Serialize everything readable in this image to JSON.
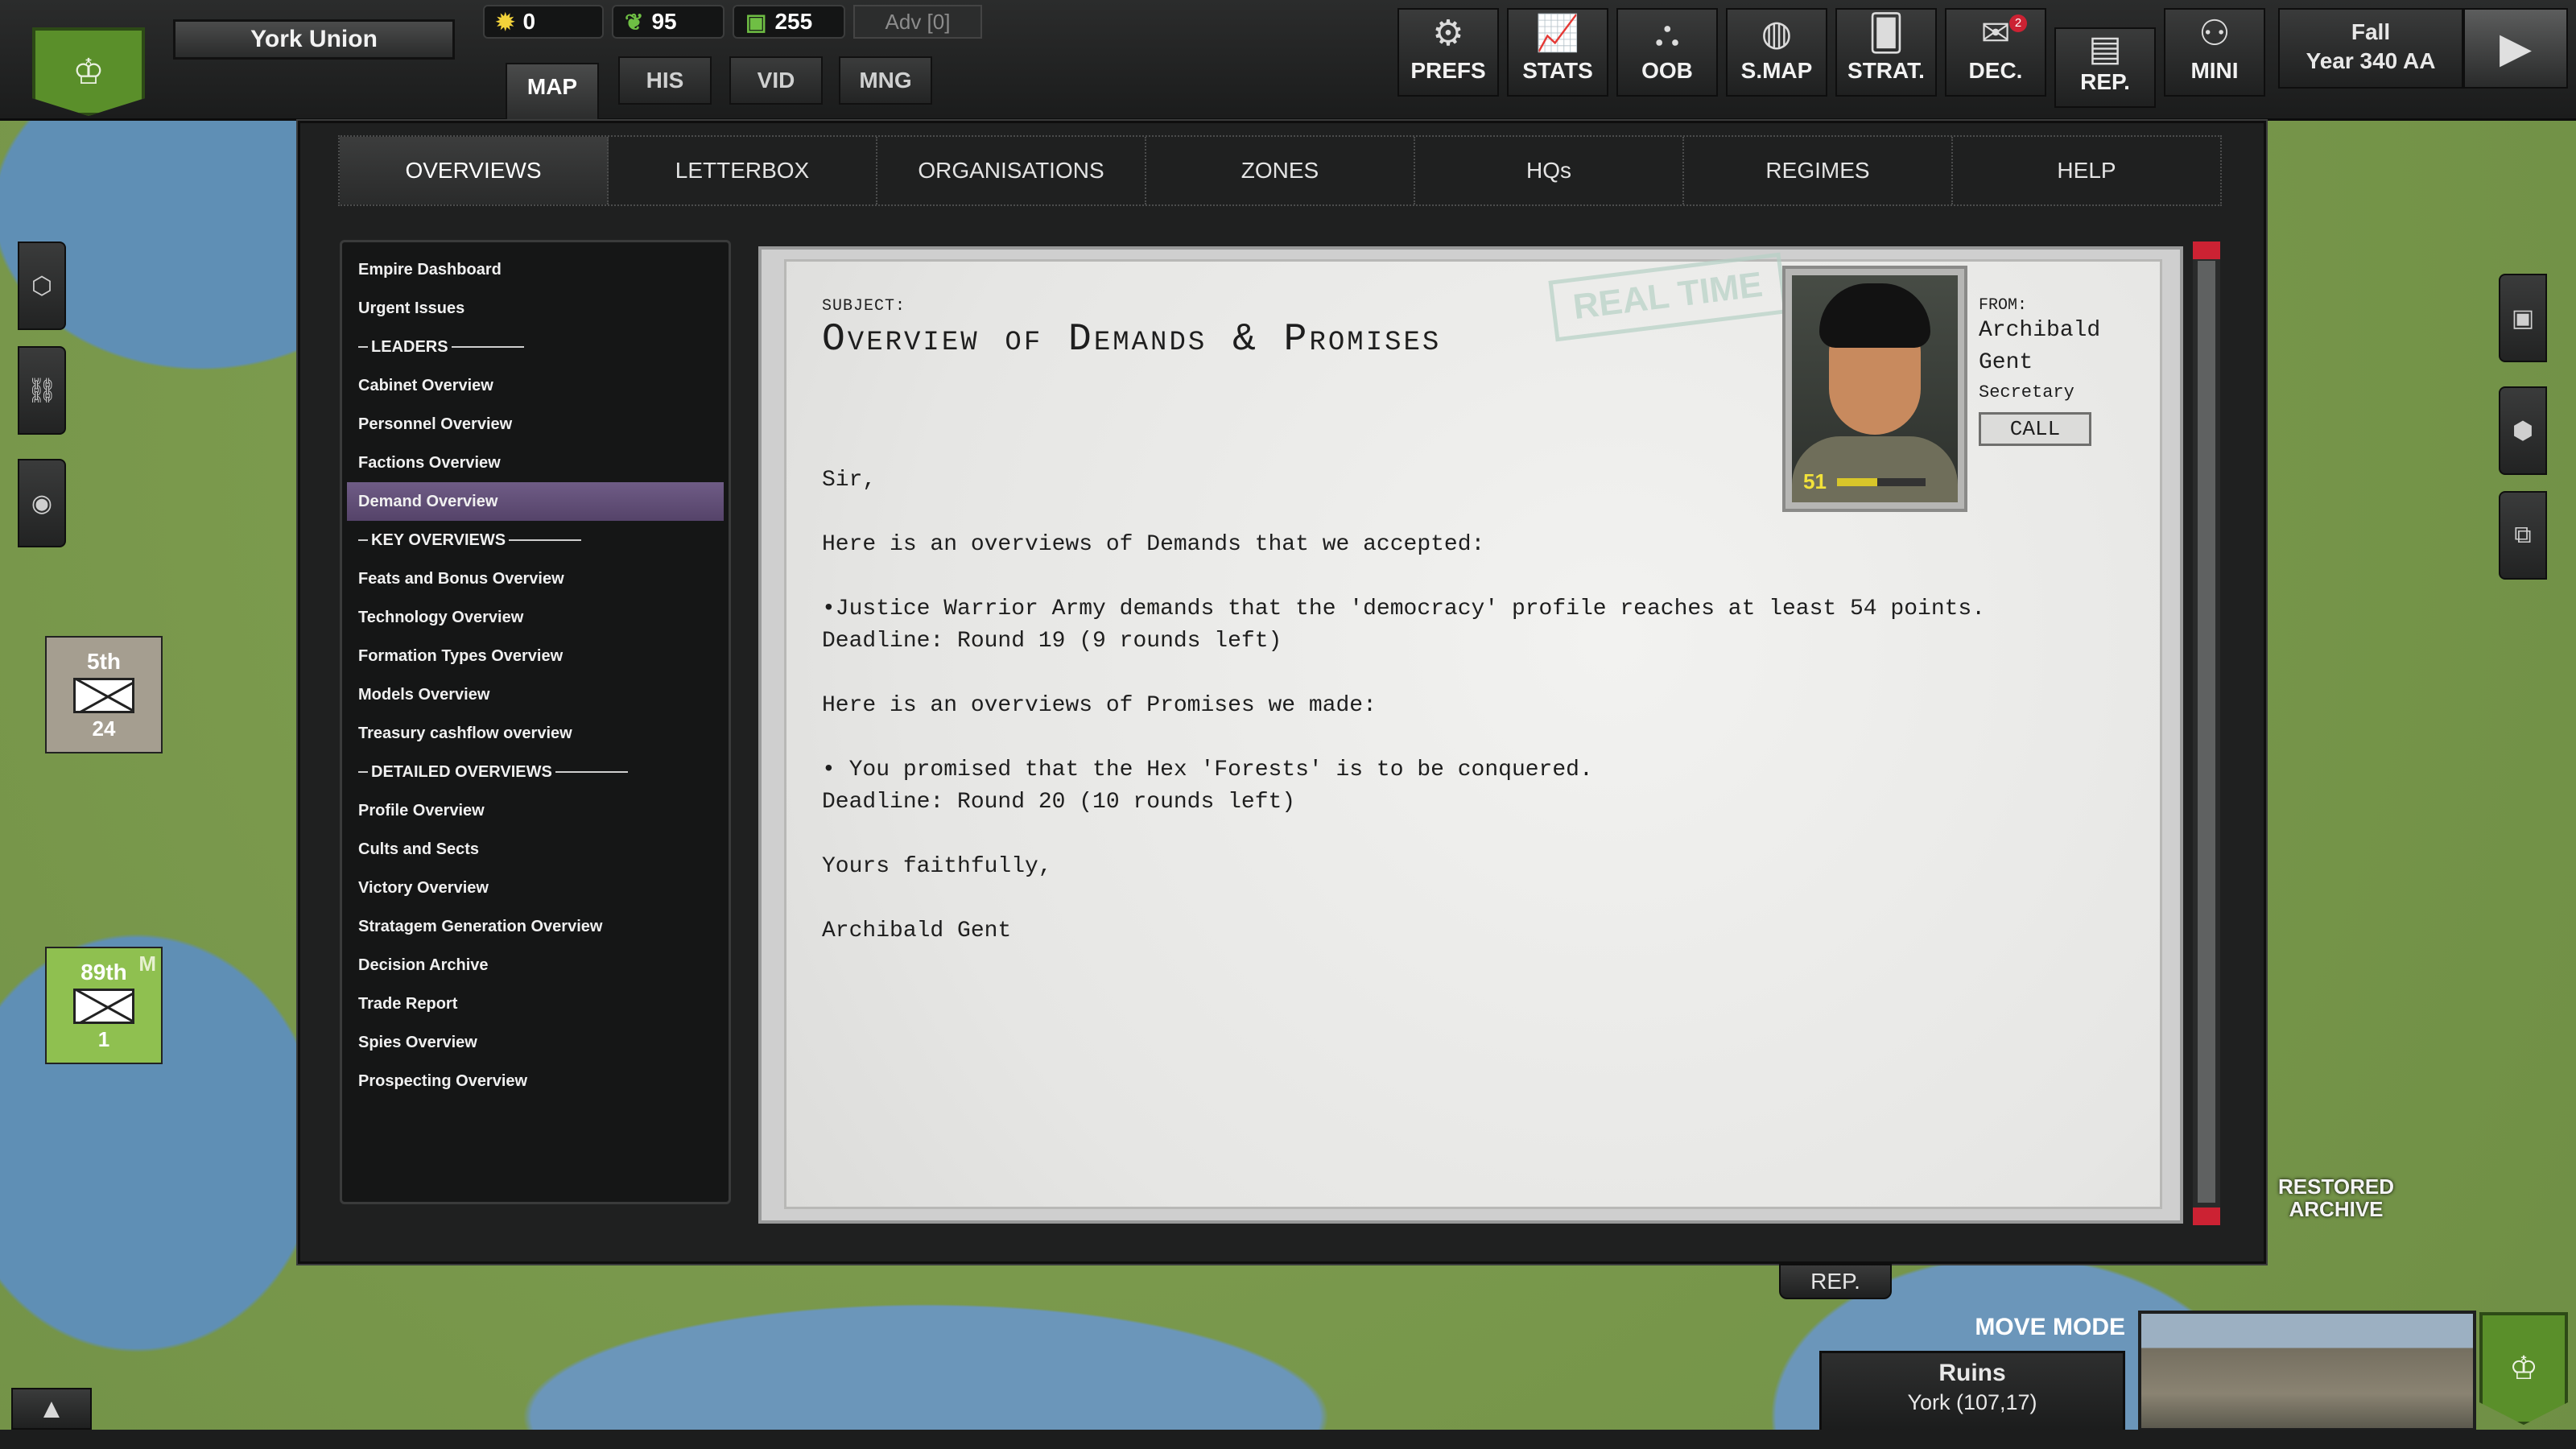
{
  "colors": {
    "active_tab": "#6f5c86",
    "faction_green": "#5a8f2a",
    "notification_red": "#cc2233"
  },
  "header": {
    "nation_name": "York Union",
    "resources": [
      {
        "icon": "sun-icon",
        "value": "0"
      },
      {
        "icon": "food-icon",
        "value": "95"
      },
      {
        "icon": "cash-icon",
        "value": "255"
      }
    ],
    "advisor": "Adv [0]",
    "view_tabs": [
      "MAP",
      "HIS",
      "VID",
      "MNG"
    ],
    "buttons": [
      {
        "name": "prefs",
        "label": "PREFS",
        "icon": "gear-icon"
      },
      {
        "name": "stats",
        "label": "STATS",
        "icon": "chart-icon"
      },
      {
        "name": "oob",
        "label": "OOB",
        "icon": "hierarchy-icon"
      },
      {
        "name": "smap",
        "label": "S.MAP",
        "icon": "globe-icon"
      },
      {
        "name": "strat",
        "label": "STRAT.",
        "icon": "cards-icon"
      },
      {
        "name": "dec",
        "label": "DEC.",
        "icon": "envelope-icon",
        "badge": "2"
      },
      {
        "name": "rep",
        "label": "REP.",
        "icon": "document-icon"
      },
      {
        "name": "mini",
        "label": "MINI",
        "icon": "person-icon"
      }
    ],
    "season": "Fall",
    "year": "Year 340 AA"
  },
  "units": [
    {
      "name": "5th",
      "strength": "24",
      "color": "#a59e90"
    },
    {
      "name": "89th",
      "strength": "1",
      "color": "#8fc050",
      "tag": "M"
    }
  ],
  "main": {
    "tabs": [
      "OVERVIEWS",
      "LETTERBOX",
      "ORGANISATIONS",
      "ZONES",
      "HQs",
      "REGIMES",
      "HELP"
    ],
    "active_tab": "OVERVIEWS",
    "list": [
      {
        "label": "Empire Dashboard"
      },
      {
        "label": "Urgent Issues"
      },
      {
        "label": "LEADERS",
        "header": true
      },
      {
        "label": "Cabinet Overview"
      },
      {
        "label": "Personnel Overview"
      },
      {
        "label": "Factions Overview"
      },
      {
        "label": "Demand Overview",
        "active": true
      },
      {
        "label": "KEY OVERVIEWS",
        "header": true
      },
      {
        "label": "Feats and Bonus Overview"
      },
      {
        "label": "Technology Overview"
      },
      {
        "label": "Formation Types Overview"
      },
      {
        "label": "Models Overview"
      },
      {
        "label": "Treasury cashflow overview"
      },
      {
        "label": "DETAILED OVERVIEWS",
        "header": true
      },
      {
        "label": "Profile Overview"
      },
      {
        "label": "Cults and Sects"
      },
      {
        "label": "Victory Overview"
      },
      {
        "label": "Stratagem Generation Overview"
      },
      {
        "label": "Decision Archive"
      },
      {
        "label": "Trade Report"
      },
      {
        "label": "Spies Overview"
      },
      {
        "label": "Prospecting Overview"
      }
    ]
  },
  "letter": {
    "subject_label": "SUBJECT:",
    "subject": "Overview of Demands & Promises",
    "stamp": "REAL TIME",
    "body": "Sir,\n\nHere is an overviews of Demands that we accepted:\n\n•Justice Warrior Army demands that the 'democracy' profile reaches at least 54 points.\nDeadline: Round 19 (9 rounds left)\n\nHere is an overviews of Promises we made:\n\n• You promised that the Hex 'Forests' is to be conquered.\nDeadline: Round 20 (10 rounds left)\n\nYours faithfully,\n\nArchibald Gent",
    "from_label": "FROM:",
    "from_name": "Archibald Gent",
    "from_role": "Secretary",
    "call_label": "CALL",
    "portrait_level": "51",
    "portrait_bar_fill": 0.45
  },
  "footer": {
    "rep_tab": "REP.",
    "mode": "MOVE MODE",
    "terrain": "Ruins",
    "location": "York (107,17)",
    "map_label": "RESTORED ARCHIVE"
  }
}
